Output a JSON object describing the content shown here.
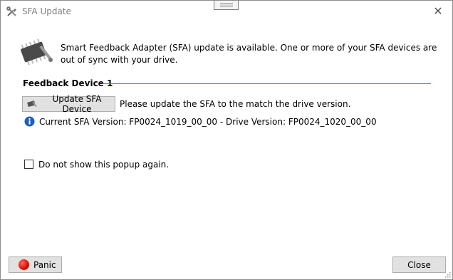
{
  "window": {
    "title": "SFA Update"
  },
  "message": {
    "text": "Smart Feedback Adapter (SFA) update is available. One or more of your SFA devices are out of sync with your drive."
  },
  "device_group": {
    "label": "Feedback Device 1",
    "update_button_label": "Update SFA Device",
    "update_note": "Please update the SFA to the match the drive version.",
    "version_text": "Current SFA Version: FP0024_1019_00_00 - Drive Version: FP0024_1020_00_00"
  },
  "options": {
    "dont_show_label": "Do not show this popup again.",
    "dont_show_checked": false
  },
  "footer": {
    "panic_label": "Panic",
    "close_label": "Close"
  },
  "icons": {
    "title": "wrench-screwdriver-icon",
    "sfa": "chip-with-tools-icon",
    "info": "info-icon",
    "panic": "red-circle-icon"
  },
  "colors": {
    "accent_line": "#3c7fd0",
    "info_blue": "#1f5fbf",
    "panic_red": "#e0100a"
  }
}
